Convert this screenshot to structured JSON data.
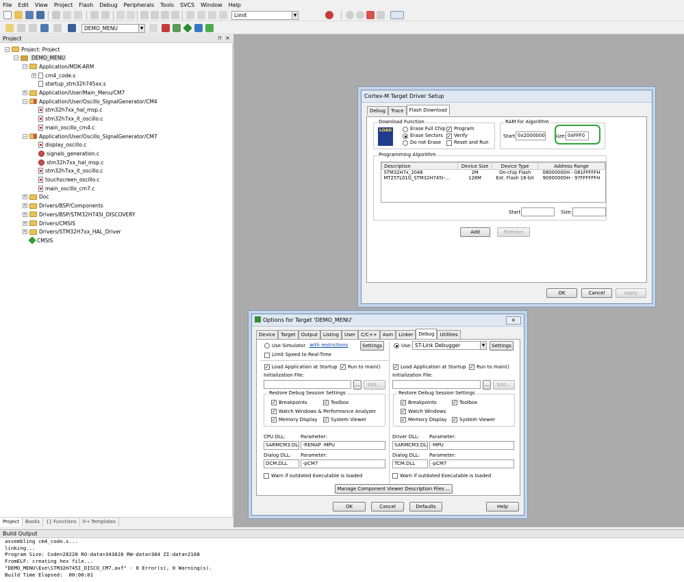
{
  "menu": [
    "File",
    "Edit",
    "View",
    "Project",
    "Flash",
    "Debug",
    "Peripherals",
    "Tools",
    "SVCS",
    "Window",
    "Help"
  ],
  "toolbar": {
    "find_combo": "Limit",
    "target_combo": "DEMO_MENU"
  },
  "project_panel": {
    "title": "Project"
  },
  "tree": [
    {
      "label": "Project: Project",
      "level": 0,
      "icon": "project",
      "exp": "−"
    },
    {
      "label": "DEMO_MENU",
      "level": 1,
      "icon": "target",
      "exp": "−"
    },
    {
      "label": "Application/MDK-ARM",
      "level": 2,
      "icon": "folder",
      "exp": "−"
    },
    {
      "label": "cm4_code.s",
      "level": 3,
      "icon": "file",
      "exp": "+"
    },
    {
      "label": "startup_stm32h745xx.s",
      "level": 3,
      "icon": "file",
      "exp": ""
    },
    {
      "label": "Application/User/Main_Menu/CM7",
      "level": 2,
      "icon": "folder",
      "exp": "+"
    },
    {
      "label": "Application/User/Oscillo_SignalGenerator/CM4",
      "level": 2,
      "icon": "gearfolder",
      "exp": "−"
    },
    {
      "label": "stm32h7xx_hal_msp.c",
      "level": 3,
      "icon": "cfile",
      "exp": ""
    },
    {
      "label": "stm32h7xx_it_oscillo.c",
      "level": 3,
      "icon": "cfile",
      "exp": ""
    },
    {
      "label": "main_oscillo_cm4.c",
      "level": 3,
      "icon": "cfile",
      "exp": ""
    },
    {
      "label": "Application/User/Oscillo_SignalGenerator/CM7",
      "level": 2,
      "icon": "gearfolder",
      "exp": "−"
    },
    {
      "label": "display_oscillo.c",
      "level": 3,
      "icon": "cfile",
      "exp": ""
    },
    {
      "label": "signals_generation.c",
      "level": 3,
      "icon": "gear",
      "exp": ""
    },
    {
      "label": "stm32h7xx_hal_msp.c",
      "level": 3,
      "icon": "gear",
      "exp": ""
    },
    {
      "label": "stm32h7xx_it_oscillo.c",
      "level": 3,
      "icon": "cfile",
      "exp": ""
    },
    {
      "label": "touchscreen_oscillo.c",
      "level": 3,
      "icon": "cfile",
      "exp": ""
    },
    {
      "label": "main_oscillo_cm7.c",
      "level": 3,
      "icon": "cfile",
      "exp": ""
    },
    {
      "label": "Doc",
      "level": 2,
      "icon": "folder",
      "exp": "+"
    },
    {
      "label": "Drivers/BSP/Components",
      "level": 2,
      "icon": "folder",
      "exp": "+"
    },
    {
      "label": "Drivers/BSP/STM32H745I_DISCOVERY",
      "level": 2,
      "icon": "folder",
      "exp": "+"
    },
    {
      "label": "Drivers/CMSIS",
      "level": 2,
      "icon": "folder",
      "exp": "+"
    },
    {
      "label": "Drivers/STM32H7xx_HAL_Driver",
      "level": 2,
      "icon": "folder",
      "exp": "+"
    },
    {
      "label": "CMSIS",
      "level": 2,
      "icon": "diamond",
      "exp": ""
    }
  ],
  "bottom_tabs": [
    "Project",
    "Books",
    "{} Functions",
    "0→ Templates"
  ],
  "build_output": {
    "title": "Build Output",
    "lines": [
      "assembling cm4_code.s...",
      "linking...",
      "Program Size: Code=28228 RO-data=343828 RW-data=384 ZI-data=2168",
      "FromELF: creating hex file...",
      "\"DEMO_MENU\\Exe\\STM32H745I_DISCO_CM7.axf\" - 0 Error(s), 0 Warning(s).",
      "Build Time Elapsed:  00:00:01"
    ]
  },
  "driver_dialog": {
    "title": "Cortex-M Target Driver Setup",
    "tabs": [
      "Debug",
      "Trace",
      "Flash Download"
    ],
    "download_function": {
      "label": "Download Function",
      "load_icon_text": "LOAD",
      "erase_full": "Erase Full Chip",
      "erase_sectors": "Erase Sectors",
      "do_not_erase": "Do not Erase",
      "program": "Program",
      "verify": "Verify",
      "reset_run": "Reset and Run"
    },
    "ram": {
      "label": "RAM for Algorithm",
      "start_label": "Start:",
      "start_value": "0x20000000",
      "size_label": "Size:",
      "size_value": "0xFFF0"
    },
    "algorithm": {
      "label": "Programming Algorithm",
      "headers": [
        "Description",
        "Device Size",
        "Device Type",
        "Address Range"
      ],
      "rows": [
        [
          "STM32H7x_2048",
          "2M",
          "On-chip Flash",
          "08000000H - 081FFFFFH"
        ],
        [
          "MT25TL01G_STM32H745I-...",
          "128M",
          "Ext. Flash 16-bit",
          "90000000H - 97FFFFFFH"
        ]
      ],
      "start_label": "Start:",
      "size_label": "Size:"
    },
    "add": "Add",
    "remove": "Remove",
    "ok": "OK",
    "cancel": "Cancel",
    "apply": "Apply",
    "highlight_color": "#2aa534"
  },
  "options_dialog": {
    "title": "Options for Target 'DEMO_MENU'",
    "tabs": [
      "Device",
      "Target",
      "Output",
      "Listing",
      "User",
      "C/C++",
      "Asm",
      "Linker",
      "Debug",
      "Utilities"
    ],
    "left": {
      "use_simulator": "Use Simulator",
      "with_restrictions": "with restrictions",
      "settings": "Settings",
      "limit_speed": "Limit Speed to Real-Time",
      "load_app": "Load Application at Startup",
      "run_main": "Run to main()",
      "init_file": "Initialization File:",
      "browse": "...",
      "edit": "Edit...",
      "restore": "Restore Debug Session Settings",
      "breakpoints": "Breakpoints",
      "toolbox": "Toolbox",
      "watch": "Watch Windows & Performance Analyzer",
      "memory": "Memory Display",
      "sysviewer": "System Viewer",
      "cpu_dll": "CPU DLL:",
      "parameter": "Parameter:",
      "cpu_dll_value": "SARMCM3.DLL",
      "cpu_param_value": "-REMAP -MPU",
      "dialog_dll": "Dialog DLL:",
      "dialog_dll_value": "DCM.DLL",
      "dialog_param_value": "-pCM7",
      "warn": "Warn if outdated Executable is loaded"
    },
    "right": {
      "use": "Use:",
      "debugger": "ST-Link Debugger",
      "settings": "Settings",
      "load_app": "Load Application at Startup",
      "run_main": "Run to main()",
      "init_file": "Initialization File:",
      "browse": "...",
      "edit": "Edit...",
      "restore": "Restore Debug Session Settings",
      "breakpoints": "Breakpoints",
      "toolbox": "Toolbox",
      "watch": "Watch Windows",
      "memory": "Memory Display",
      "sysviewer": "System Viewer",
      "driver_dll": "Driver DLL:",
      "parameter": "Parameter:",
      "driver_dll_value": "SARMCM3.DLL",
      "driver_param_value": "-MPU",
      "dialog_dll": "Dialog DLL:",
      "dialog_dll_value": "TCM.DLL",
      "dialog_param_value": "-pCM7",
      "warn": "Warn if outdated Executable is loaded"
    },
    "manage": "Manage Component Viewer Description Files ...",
    "ok": "OK",
    "cancel": "Cancel",
    "defaults": "Defaults",
    "help": "Help"
  }
}
